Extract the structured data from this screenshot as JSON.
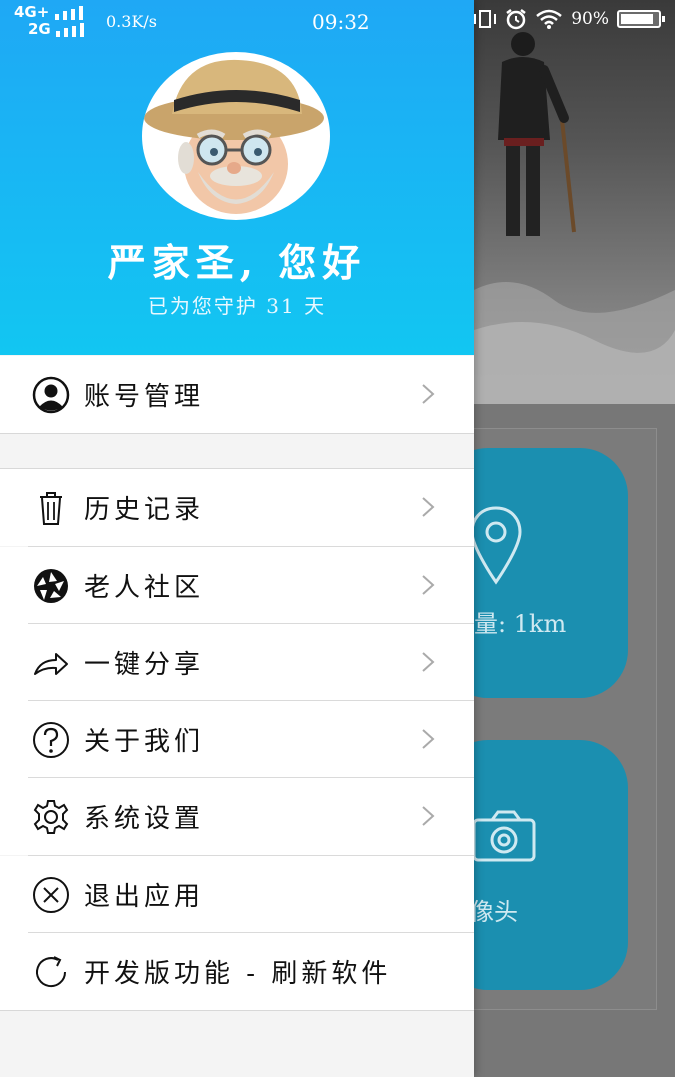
{
  "status_bar": {
    "network_top": "4G+",
    "network_bottom": "2G",
    "speed": "0.3K/s",
    "time": "09:32",
    "battery_text": "90%",
    "battery_level": 0.9
  },
  "drawer": {
    "greeting": "严家圣, 您好",
    "sub_greeting": "已为您守护 31 天",
    "avatar_icon": "old-man-avatar-icon",
    "account_item": {
      "label": "账号管理",
      "icon": "person-icon"
    },
    "items": [
      {
        "label": "历史记录",
        "icon": "trash-icon",
        "chevron": true
      },
      {
        "label": "老人社区",
        "icon": "aperture-icon",
        "chevron": true
      },
      {
        "label": "一键分享",
        "icon": "share-icon",
        "chevron": true
      },
      {
        "label": "关于我们",
        "icon": "question-icon",
        "chevron": true
      },
      {
        "label": "系统设置",
        "icon": "gear-icon",
        "chevron": true
      },
      {
        "label": "退出应用",
        "icon": "close-circle-icon",
        "chevron": false
      },
      {
        "label": "开发版功能 - 刷新软件",
        "icon": "refresh-icon",
        "chevron": false
      }
    ]
  },
  "background_app": {
    "tile1_text": "量: 1km",
    "tile1_icon": "location-pin-icon",
    "tile2_text": "像头",
    "tile2_icon": "camera-icon"
  },
  "colors": {
    "header_top": "#1fa8f5",
    "header_bottom": "#12c6f2",
    "tile": "#1b8fb0"
  }
}
